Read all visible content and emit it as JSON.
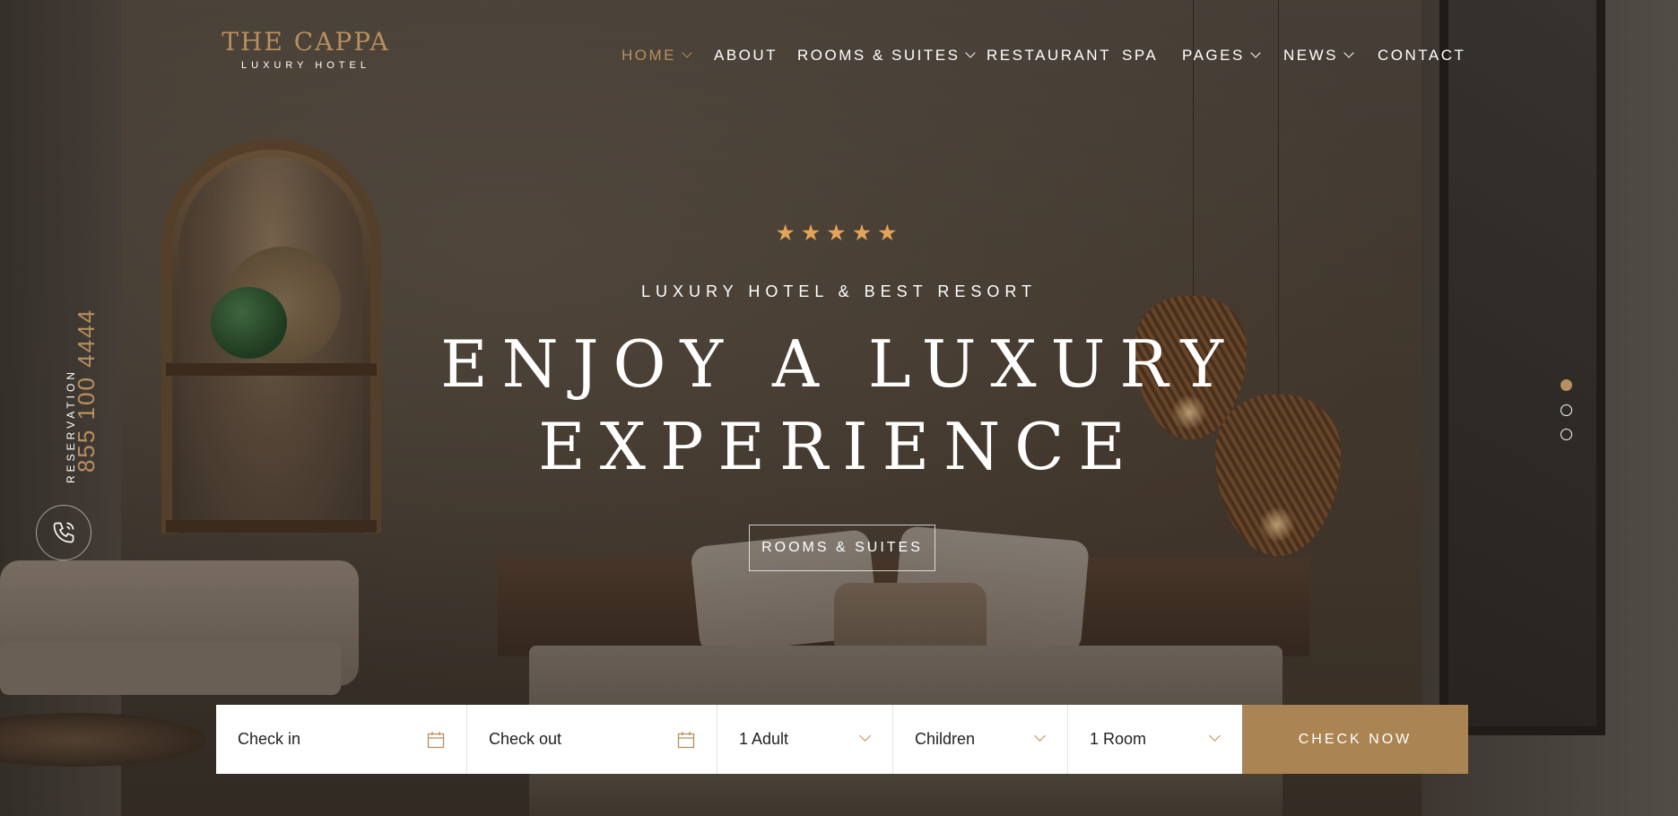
{
  "brand": {
    "name": "THE CAPPA",
    "tagline": "LUXURY HOTEL"
  },
  "nav": {
    "items": [
      {
        "label": "HOME",
        "active": true,
        "dropdown": true
      },
      {
        "label": "ABOUT",
        "active": false,
        "dropdown": false
      },
      {
        "label": "ROOMS & SUITES",
        "active": false,
        "dropdown": true
      },
      {
        "label": "RESTAURANT",
        "active": false,
        "dropdown": false
      },
      {
        "label": "SPA",
        "active": false,
        "dropdown": false
      },
      {
        "label": "PAGES",
        "active": false,
        "dropdown": true
      },
      {
        "label": "NEWS",
        "active": false,
        "dropdown": true
      },
      {
        "label": "CONTACT",
        "active": false,
        "dropdown": false
      }
    ]
  },
  "reservation": {
    "label": "RESERVATION",
    "phone": "855 100 4444",
    "icon": "phone-icon"
  },
  "hero": {
    "rating": 5,
    "stars": "★★★★★",
    "kicker": "LUXURY HOTEL & BEST RESORT",
    "headline_line1": "ENJOY A LUXURY",
    "headline_line2": "EXPERIENCE",
    "cta_label": "ROOMS & SUITES"
  },
  "slider": {
    "total": 3,
    "active_index": 0
  },
  "booking": {
    "check_in": "Check in",
    "check_out": "Check out",
    "adults": "1 Adult",
    "children": "Children",
    "rooms": "1 Room",
    "submit_label": "CHECK NOW"
  },
  "colors": {
    "accent": "#b88f5e",
    "button": "#aa8453",
    "stars": "#e4a457"
  }
}
